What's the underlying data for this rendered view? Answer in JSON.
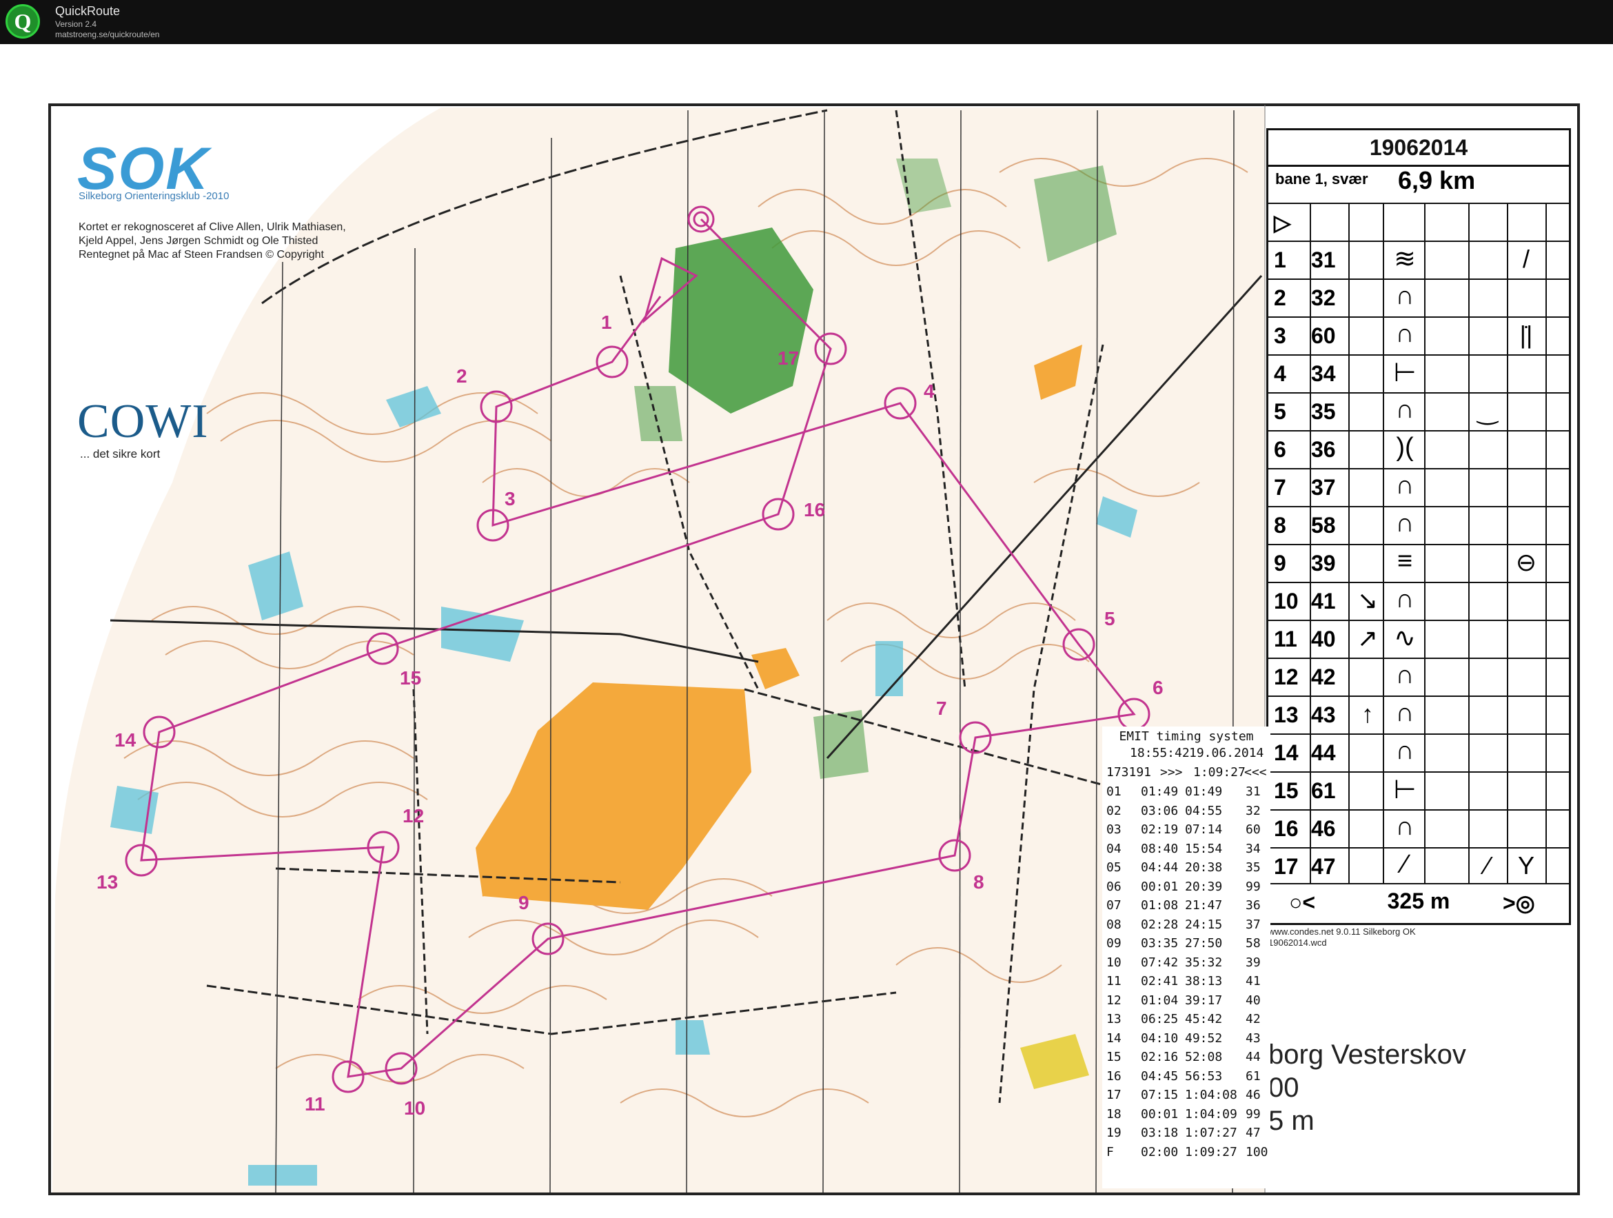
{
  "app": {
    "title": "QuickRoute",
    "version": "Version 2.4",
    "url": "matstroeng.se/quickroute/en",
    "logo_letter": "Q"
  },
  "club": {
    "logo": "SOK",
    "subtitle": "Silkeborg Orienteringsklub -2010",
    "credits": [
      "Kortet er rekognosceret af Clive Allen, Ulrik Mathiasen,",
      "Kjeld Appel, Jens Jørgen Schmidt og Ole Thisted",
      "Rentegnet på Mac af Steen Frandsen   © Copyright"
    ]
  },
  "sponsor": {
    "name": "COWI",
    "tagline": "... det sikre kort"
  },
  "controls": [
    {
      "label": "1"
    },
    {
      "label": "2"
    },
    {
      "label": "3"
    },
    {
      "label": "4"
    },
    {
      "label": "5"
    },
    {
      "label": "6"
    },
    {
      "label": "7"
    },
    {
      "label": "8"
    },
    {
      "label": "9"
    },
    {
      "label": "10"
    },
    {
      "label": "11"
    },
    {
      "label": "12"
    },
    {
      "label": "13"
    },
    {
      "label": "14"
    },
    {
      "label": "15"
    },
    {
      "label": "16"
    },
    {
      "label": "17"
    }
  ],
  "description_sheet": {
    "date": "19062014",
    "course": "bane 1, svær",
    "length": "6,9 km",
    "start_symbol": "▷",
    "rows": [
      {
        "num": "1",
        "code": "31",
        "dir": "",
        "sym": "≋",
        "extra": "",
        "extra2": "/"
      },
      {
        "num": "2",
        "code": "32",
        "dir": "",
        "sym": "∩",
        "extra": "",
        "extra2": ""
      },
      {
        "num": "3",
        "code": "60",
        "dir": "",
        "sym": "∩",
        "extra": "",
        "extra2": "|̇|"
      },
      {
        "num": "4",
        "code": "34",
        "dir": "",
        "sym": "⊢",
        "extra": "",
        "extra2": ""
      },
      {
        "num": "5",
        "code": "35",
        "dir": "",
        "sym": "∩",
        "extra": "‿",
        "extra2": ""
      },
      {
        "num": "6",
        "code": "36",
        "dir": "",
        "sym": ")(",
        "extra": "",
        "extra2": ""
      },
      {
        "num": "7",
        "code": "37",
        "dir": "",
        "sym": "∩",
        "extra": "",
        "extra2": ""
      },
      {
        "num": "8",
        "code": "58",
        "dir": "",
        "sym": "∩",
        "extra": "",
        "extra2": ""
      },
      {
        "num": "9",
        "code": "39",
        "dir": "",
        "sym": "≡",
        "extra": "",
        "extra2": "⊖"
      },
      {
        "num": "10",
        "code": "41",
        "dir": "↘",
        "sym": "∩",
        "extra": "",
        "extra2": ""
      },
      {
        "num": "11",
        "code": "40",
        "dir": "↗",
        "sym": "∿",
        "extra": "",
        "extra2": ""
      },
      {
        "num": "12",
        "code": "42",
        "dir": "",
        "sym": "∩",
        "extra": "",
        "extra2": ""
      },
      {
        "num": "13",
        "code": "43",
        "dir": "↑",
        "sym": "∩",
        "extra": "",
        "extra2": ""
      },
      {
        "num": "14",
        "code": "44",
        "dir": "",
        "sym": "∩",
        "extra": "",
        "extra2": ""
      },
      {
        "num": "15",
        "code": "61",
        "dir": "",
        "sym": "⊢",
        "extra": "",
        "extra2": ""
      },
      {
        "num": "16",
        "code": "46",
        "dir": "",
        "sym": "∩",
        "extra": "",
        "extra2": ""
      },
      {
        "num": "17",
        "code": "47",
        "dir": "",
        "sym": "⁄",
        "extra": "⁄",
        "extra2": "Y"
      }
    ],
    "finish_left": "○<",
    "finish_distance": "325 m",
    "finish_right": ">◎"
  },
  "condes": {
    "line1": "www.condes.net 9.0.11 Silkeborg OK",
    "line2": "19062014.wcd"
  },
  "place": {
    "line1": "borg Vesterskov",
    "line2": "00",
    "line3": "5 m"
  },
  "receipt": {
    "title": "EMIT timing system",
    "time": "18:55:42",
    "date": "19.06.2014",
    "id": "173191",
    "arrows_in": ">>>",
    "total": "1:09:27",
    "arrows_out": "<<<",
    "splits": [
      {
        "n": "01",
        "leg": "01:49",
        "cum": "01:49",
        "code": "31"
      },
      {
        "n": "02",
        "leg": "03:06",
        "cum": "04:55",
        "code": "32"
      },
      {
        "n": "03",
        "leg": "02:19",
        "cum": "07:14",
        "code": "60"
      },
      {
        "n": "04",
        "leg": "08:40",
        "cum": "15:54",
        "code": "34"
      },
      {
        "n": "05",
        "leg": "04:44",
        "cum": "20:38",
        "code": "35"
      },
      {
        "n": "06",
        "leg": "00:01",
        "cum": "20:39",
        "code": "99"
      },
      {
        "n": "07",
        "leg": "01:08",
        "cum": "21:47",
        "code": "36"
      },
      {
        "n": "08",
        "leg": "02:28",
        "cum": "24:15",
        "code": "37"
      },
      {
        "n": "09",
        "leg": "03:35",
        "cum": "27:50",
        "code": "58"
      },
      {
        "n": "10",
        "leg": "07:42",
        "cum": "35:32",
        "code": "39"
      },
      {
        "n": "11",
        "leg": "02:41",
        "cum": "38:13",
        "code": "41"
      },
      {
        "n": "12",
        "leg": "01:04",
        "cum": "39:17",
        "code": "40"
      },
      {
        "n": "13",
        "leg": "06:25",
        "cum": "45:42",
        "code": "42"
      },
      {
        "n": "14",
        "leg": "04:10",
        "cum": "49:52",
        "code": "43"
      },
      {
        "n": "15",
        "leg": "02:16",
        "cum": "52:08",
        "code": "44"
      },
      {
        "n": "16",
        "leg": "04:45",
        "cum": "56:53",
        "code": "61"
      },
      {
        "n": "17",
        "leg": "07:15",
        "cum": "1:04:08",
        "code": "46"
      },
      {
        "n": "18",
        "leg": "00:01",
        "cum": "1:04:09",
        "code": "99"
      },
      {
        "n": "19",
        "leg": "03:18",
        "cum": "1:07:27",
        "code": "47"
      },
      {
        "n": "F",
        "leg": "02:00",
        "cum": "1:09:27",
        "code": "100"
      }
    ]
  },
  "colors": {
    "course": "#c2338f",
    "forest_green": "#3f9a3a",
    "open_yellow": "#f4a93c",
    "water_blue": "#5fc3d9",
    "contour_brown": "#c77b45",
    "track": "#222222"
  }
}
